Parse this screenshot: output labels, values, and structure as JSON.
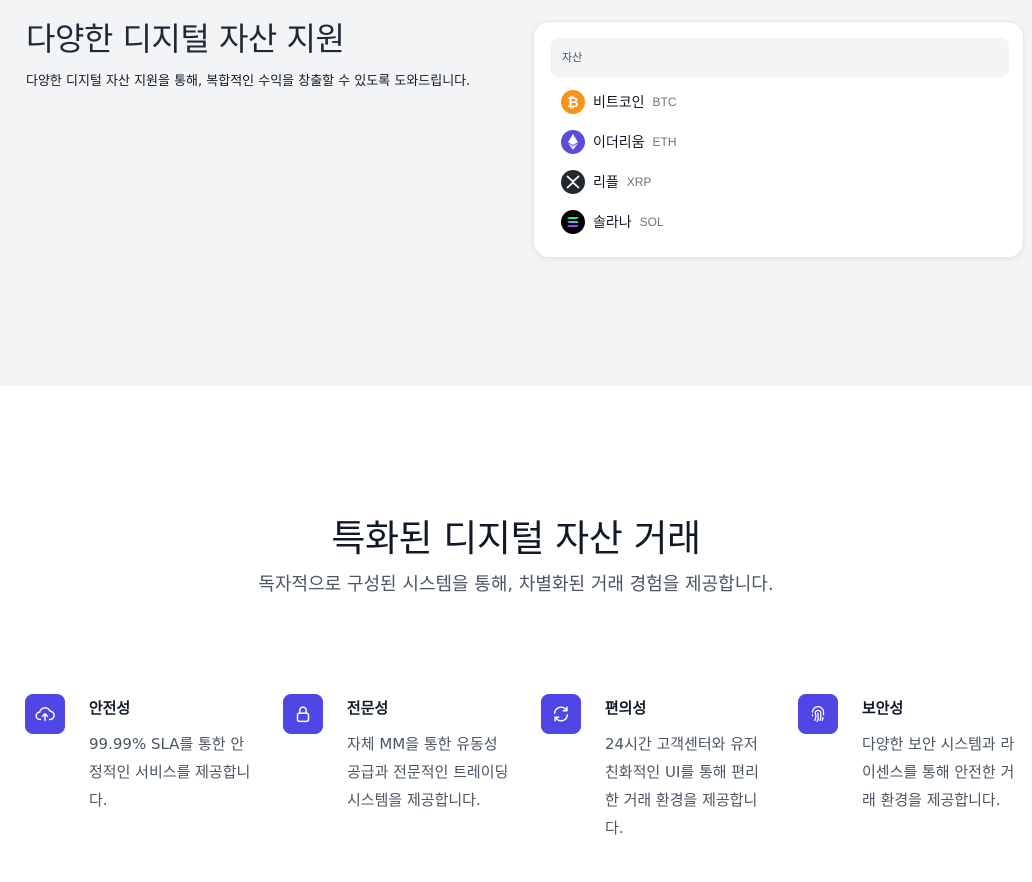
{
  "hero": {
    "title": "다양한 디지털 자산 지원",
    "description": "다양한 디지털 자산 지원을 통해, 복합적인 수익을 창출할 수 있도록 도와드립니다."
  },
  "assets": {
    "header": "자산",
    "items": [
      {
        "name": "비트코인",
        "symbol": "BTC",
        "icon": "bitcoin-icon",
        "color": "#f7931a"
      },
      {
        "name": "이더리움",
        "symbol": "ETH",
        "icon": "ethereum-icon",
        "color": "#5b4bd9"
      },
      {
        "name": "리플",
        "symbol": "XRP",
        "icon": "xrp-icon",
        "color": "#23292f"
      },
      {
        "name": "솔라나",
        "symbol": "SOL",
        "icon": "solana-icon",
        "color": "#000000"
      }
    ]
  },
  "section": {
    "title": "특화된 디지털 자산 거래",
    "subtitle": "독자적으로 구성된 시스템을 통해, 차별화된 거래 경험을 제공합니다."
  },
  "features": [
    {
      "title": "안전성",
      "description": "99.99% SLA를 통한 안정적인 서비스를 제공합니다.",
      "icon": "cloud-upload-icon"
    },
    {
      "title": "전문성",
      "description": "자체 MM을 통한 유동성 공급과 전문적인 트레이딩 시스템을 제공합니다.",
      "icon": "lock-icon"
    },
    {
      "title": "편의성",
      "description": "24시간 고객센터와 유저 친화적인 UI를 통해 편리한 거래 환경을 제공합니다.",
      "icon": "refresh-icon"
    },
    {
      "title": "보안성",
      "description": "다양한 보안 시스템과 라이센스를 통해 안전한 거래 환경을 제공합니다.",
      "icon": "fingerprint-icon"
    }
  ],
  "colors": {
    "accent": "#4f46e5",
    "hero_bg": "#f3f4f6"
  }
}
